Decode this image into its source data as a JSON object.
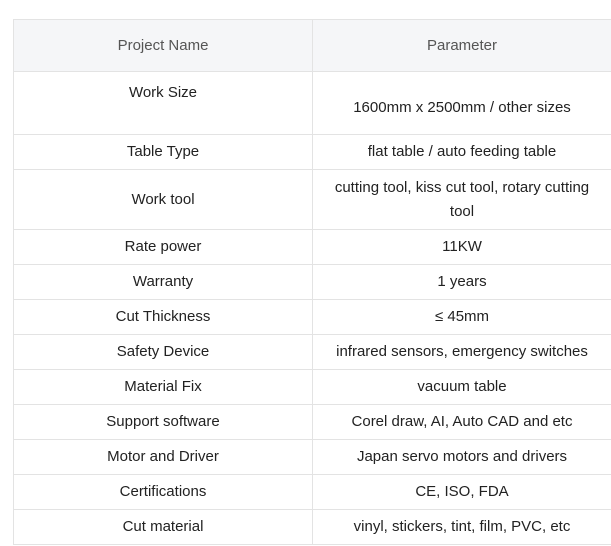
{
  "table": {
    "headers": [
      "Project Name",
      "Parameter"
    ],
    "rows": [
      {
        "name": "Work Size",
        "value": "1600mm x 2500mm / other sizes"
      },
      {
        "name": "Table Type",
        "value": "flat table / auto feeding table"
      },
      {
        "name": "Work tool",
        "value": "cutting tool, kiss cut tool, rotary cutting tool"
      },
      {
        "name": "Rate power",
        "value": "11KW"
      },
      {
        "name": "Warranty",
        "value": "1 years"
      },
      {
        "name": "Cut Thickness",
        "value": "≤ 45mm"
      },
      {
        "name": "Safety Device",
        "value": "infrared sensors, emergency switches"
      },
      {
        "name": "Material Fix",
        "value": "vacuum table"
      },
      {
        "name": "Support software",
        "value": "Corel draw, AI, Auto CAD and etc"
      },
      {
        "name": "Motor and Driver",
        "value": "Japan servo motors and drivers"
      },
      {
        "name": "Certifications",
        "value": "CE, ISO, FDA"
      },
      {
        "name": "Cut material",
        "value": "vinyl, stickers, tint, film, PVC, etc"
      }
    ]
  }
}
